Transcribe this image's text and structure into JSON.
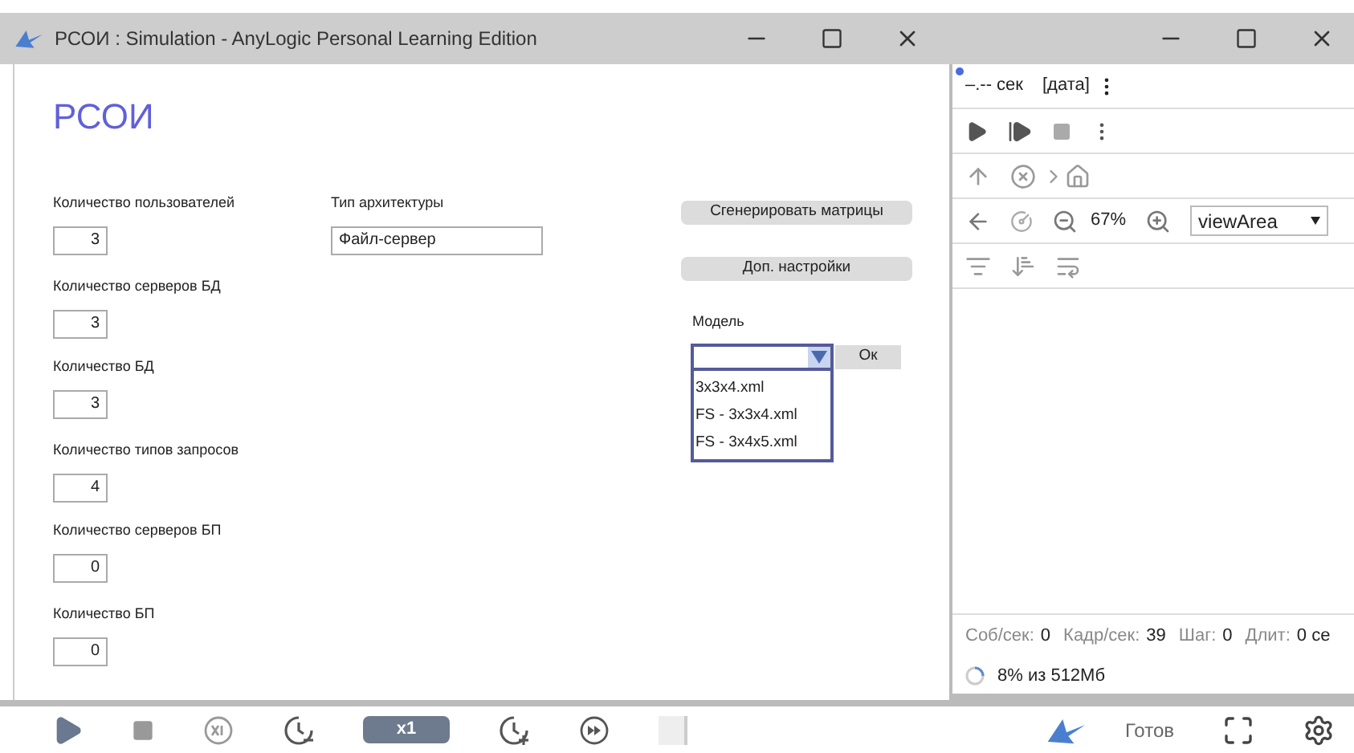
{
  "window": {
    "title": "РСОИ : Simulation - AnyLogic Personal Learning Edition"
  },
  "heading": "РСОИ",
  "fields_left": [
    {
      "label": "Количество пользователей",
      "value": "3"
    },
    {
      "label": "Количество серверов БД",
      "value": "3"
    },
    {
      "label": "Количество БД",
      "value": "3"
    },
    {
      "label": "Количество типов запросов",
      "value": "4"
    },
    {
      "label": "Количество серверов БП",
      "value": "0"
    },
    {
      "label": "Количество БП",
      "value": "0"
    }
  ],
  "architecture": {
    "label": "Тип архитектуры",
    "value": "Файл-сервер"
  },
  "buttons": [
    "Сгенерировать матрицы",
    "Доп. настройки"
  ],
  "model": {
    "label": "Модель",
    "expanded": true,
    "ok": "Ок",
    "options": [
      {
        "label": "3x3x4.xml",
        "selected": false
      },
      {
        "label": "FS - 3x3x4.xml",
        "selected": false
      },
      {
        "label": "FS - 3x4x5.xml",
        "selected": false
      }
    ]
  },
  "side": {
    "time": "–.-- сек",
    "date": "[дата]",
    "zoom": "67%",
    "view": "viewArea",
    "stats": [
      {
        "label": "Соб/сек:",
        "value": "0"
      },
      {
        "label": "Кадр/сек:",
        "value": "39"
      },
      {
        "label": "Шаг:",
        "value": "0"
      },
      {
        "label": "Длит:",
        "value": "0 се"
      }
    ],
    "memory": "8% из 512Мб"
  },
  "toolbar": {
    "speed": "x1",
    "status": "Готов"
  }
}
